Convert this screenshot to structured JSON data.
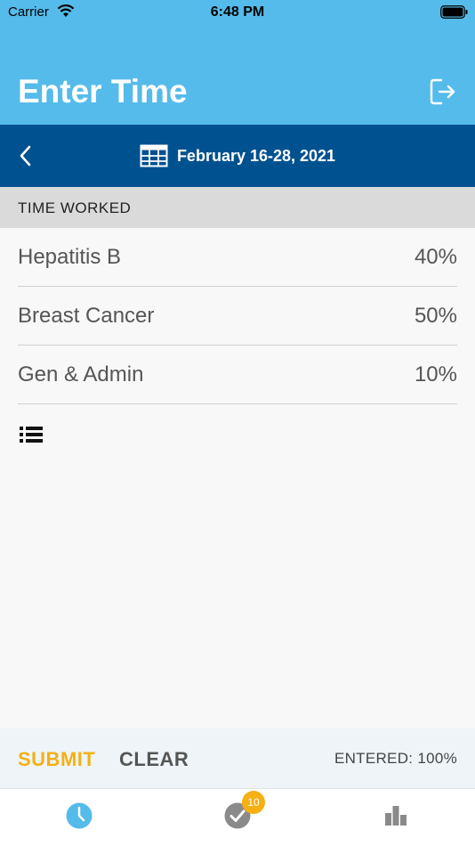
{
  "status_bar": {
    "carrier": "Carrier",
    "time": "6:48 PM"
  },
  "header": {
    "title": "Enter Time"
  },
  "date_bar": {
    "date_range": "February 16-28, 2021"
  },
  "section": {
    "title": "TIME WORKED"
  },
  "entries": [
    {
      "name": "Hepatitis B",
      "percent": "40%"
    },
    {
      "name": "Breast Cancer",
      "percent": "50%"
    },
    {
      "name": "Gen & Admin",
      "percent": "10%"
    }
  ],
  "actions": {
    "submit_label": "SUBMIT",
    "clear_label": "CLEAR",
    "entered": "ENTERED: 100%"
  },
  "tab_bar": {
    "tabs": [
      {
        "icon": "clock-icon",
        "active": true
      },
      {
        "icon": "checkmark-icon",
        "badge": "10"
      },
      {
        "icon": "bar-chart-icon"
      }
    ]
  },
  "colors": {
    "header": "#55bbea",
    "date_bar": "#005190",
    "accent": "#f5b014",
    "active_tab": "#55bbea",
    "inactive_tab": "#8a8a8a"
  }
}
